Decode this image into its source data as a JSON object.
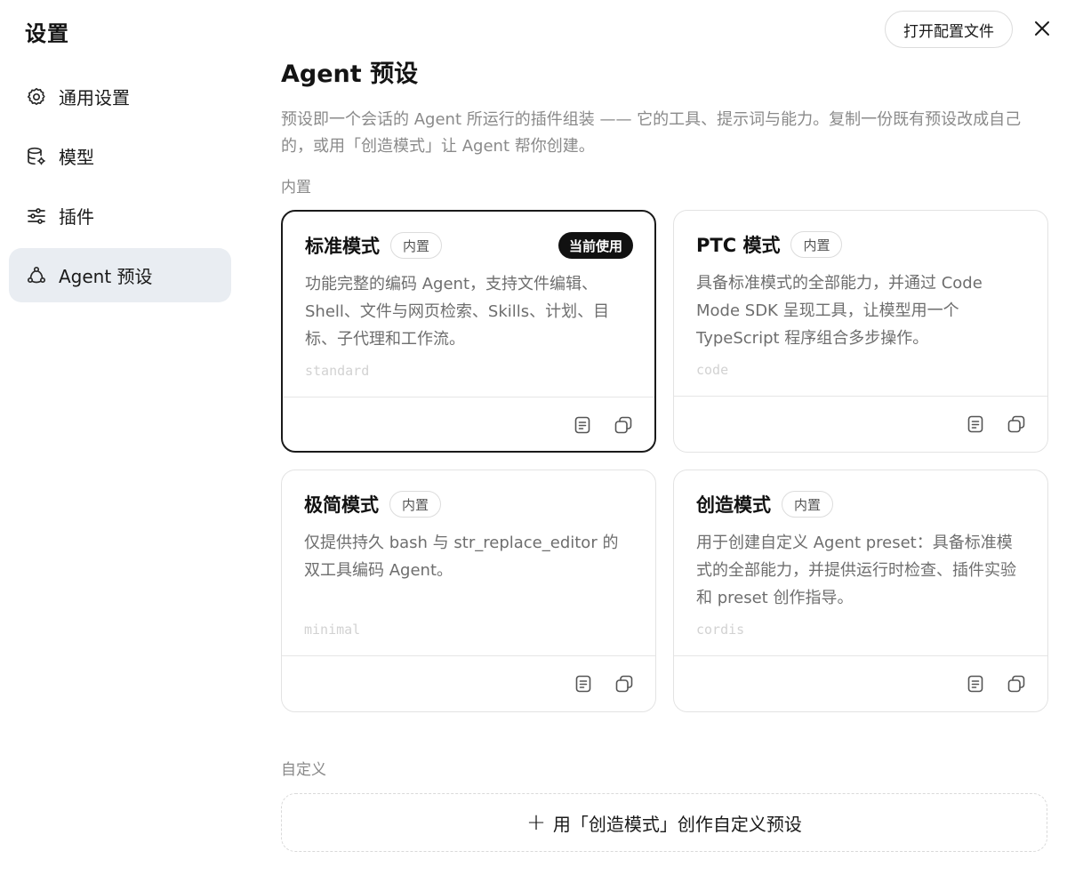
{
  "app": {
    "title": "设置"
  },
  "sidebar": {
    "items": [
      {
        "label": "通用设置",
        "icon": "gear-icon"
      },
      {
        "label": "模型",
        "icon": "database-gear-icon"
      },
      {
        "label": "插件",
        "icon": "sliders-icon"
      },
      {
        "label": "Agent 预设",
        "icon": "agent-nodes-icon",
        "active": true
      }
    ]
  },
  "header": {
    "open_config_label": "打开配置文件",
    "close_icon": "close-icon"
  },
  "main": {
    "title": "Agent 预设",
    "description": "预设即一个会话的 Agent 所运行的插件组装 —— 它的工具、提示词与能力。复制一份既有预设改成自己的，或用「创造模式」让 Agent 帮你创建。",
    "builtin_section_label": "内置",
    "custom_section_label": "自定义",
    "presets": [
      {
        "name": "标准模式",
        "badge": "内置",
        "current_badge": "当前使用",
        "description": "功能完整的编码 Agent，支持文件编辑、Shell、文件与网页检索、Skills、计划、目标、子代理和工作流。",
        "slug": "standard",
        "current": true
      },
      {
        "name": "PTC 模式",
        "badge": "内置",
        "description": "具备标准模式的全部能力，并通过 Code Mode SDK 呈现工具，让模型用一个 TypeScript 程序组合多步操作。",
        "slug": "code",
        "current": false
      },
      {
        "name": "极简模式",
        "badge": "内置",
        "description": "仅提供持久 bash 与 str_replace_editor 的双工具编码 Agent。",
        "slug": "minimal",
        "current": false
      },
      {
        "name": "创造模式",
        "badge": "内置",
        "description": "用于创建自定义 Agent preset：具备标准模式的全部能力，并提供运行时检查、插件实验和 preset 创作指导。",
        "slug": "cordis",
        "current": false
      }
    ],
    "add_preset": {
      "plus": "+",
      "label": "用「创造模式」创作自定义预设"
    }
  },
  "colors": {
    "accent_dark": "#111111",
    "nav_active_bg": "#e9edf2",
    "muted_text": "#8a8a8a"
  }
}
